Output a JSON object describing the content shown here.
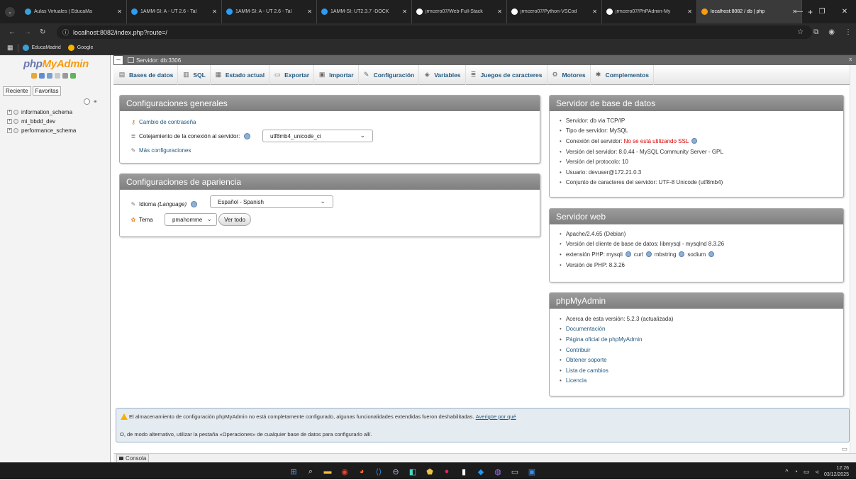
{
  "browser": {
    "tabs": [
      {
        "title": "Aulas Virtuales | EducaMa",
        "icon": "educamadrid-icon",
        "color": "#3aa0d8"
      },
      {
        "title": "1AMM-SI: A - UT 2.6 - Tal",
        "icon": "moodle-icon",
        "color": "#2a9df4"
      },
      {
        "title": "1AMM-SI: A - UT 2.6 - Tal",
        "icon": "moodle-icon",
        "color": "#2a9df4"
      },
      {
        "title": "1AMM-SI: UT2.3.7 -DOCK",
        "icon": "moodle-icon",
        "color": "#2a9df4"
      },
      {
        "title": "jrmcero07/Web-Full-Stack",
        "icon": "github-icon",
        "color": "#ffffff"
      },
      {
        "title": "jrmcero07/Python-VSCod",
        "icon": "github-icon",
        "color": "#ffffff"
      },
      {
        "title": "jrmcero07/PhPAdmin-My",
        "icon": "github-icon",
        "color": "#ffffff"
      },
      {
        "title": "localhost:8082 / db | php",
        "icon": "phpmyadmin-icon",
        "color": "#f89c0e",
        "active": true
      }
    ],
    "url": "localhost:8082/index.php?route=/",
    "bookmarks": [
      {
        "label": "EducaMadrid",
        "color": "#3aa0d8"
      },
      {
        "label": "Google",
        "color": "#f4b400"
      }
    ]
  },
  "pma": {
    "logo_a": "php",
    "logo_b": "MyAdmin",
    "nav_tabs": [
      "Reciente",
      "Favoritas"
    ],
    "databases": [
      "information_schema",
      "mi_bbdd_dev",
      "performance_schema"
    ],
    "breadcrumb": "Servidor: db:3306",
    "menu": [
      {
        "label": "Bases de datos",
        "icon": "databases-icon",
        "glyph": "▤"
      },
      {
        "label": "SQL",
        "icon": "sql-icon",
        "glyph": "▥"
      },
      {
        "label": "Estado actual",
        "icon": "status-icon",
        "glyph": "▦"
      },
      {
        "label": "Exportar",
        "icon": "export-icon",
        "glyph": "▭"
      },
      {
        "label": "Importar",
        "icon": "import-icon",
        "glyph": "▣"
      },
      {
        "label": "Configuración",
        "icon": "wrench-icon",
        "glyph": "✎"
      },
      {
        "label": "Variables",
        "icon": "variables-icon",
        "glyph": "◈"
      },
      {
        "label": "Juegos de caracteres",
        "icon": "charset-icon",
        "glyph": "≣"
      },
      {
        "label": "Motores",
        "icon": "engines-icon",
        "glyph": "⚙"
      },
      {
        "label": "Complementos",
        "icon": "plugins-icon",
        "glyph": "✱"
      }
    ],
    "general": {
      "title": "Configuraciones generales",
      "change_password": "Cambio de contraseña",
      "collation_label": "Cotejamiento de la conexión al servidor:",
      "collation_value": "utf8mb4_unicode_ci",
      "more_settings": "Más configuraciones"
    },
    "appearance": {
      "title": "Configuraciones de apariencia",
      "language_label": "Idioma",
      "language_en": "(Language)",
      "language_value": "Español - Spanish",
      "theme_label": "Tema",
      "theme_value": "pmahomme",
      "view_all": "Ver todo"
    },
    "db_server": {
      "title": "Servidor de base de datos",
      "server": "Servidor: db via TCP/IP",
      "type": "Tipo de servidor: MySQL",
      "conn_label": "Conexión del servidor:",
      "conn_value": "No se está utilizando SSL",
      "version": "Versión del servidor: 8.0.44 - MySQL Community Server - GPL",
      "protocol": "Versión del protocolo: 10",
      "user": "Usuario: devuser@172.21.0.3",
      "charset": "Conjunto de caracteres del servidor: UTF-8 Unicode (utf8mb4)"
    },
    "web_server": {
      "title": "Servidor web",
      "apache": "Apache/2.4.65 (Debian)",
      "client": "Versión del cliente de base de datos: libmysql - mysqlnd 8.3.26",
      "ext_label": "extensión PHP: mysqli",
      "ext_curl": "curl",
      "ext_mbstring": "mbstring",
      "ext_sodium": "sodium",
      "php_version": "Versión de PHP: 8.3.26"
    },
    "pma_panel": {
      "title": "phpMyAdmin",
      "about": "Acerca de esta versión: 5.2.3 (actualizada)",
      "links": [
        "Documentación",
        "Página oficial de phpMyAdmin",
        "Contribuir",
        "Obtener soporte",
        "Lista de cambios",
        "Licencia"
      ]
    },
    "notice": {
      "text": "El almacenamiento de configuración phpMyAdmin no está completamente configurado, algunas funcionalidades extendidas fueron deshabilitadas.",
      "link": "Averigüe por qué",
      "alt": "O, de modo alternativo, utilizar la pestaña «Operaciones» de cualquier base de datos para configurarlo allí."
    },
    "console": "Consola"
  },
  "taskbar": {
    "time": "12:26",
    "date": "03/12/2025"
  }
}
